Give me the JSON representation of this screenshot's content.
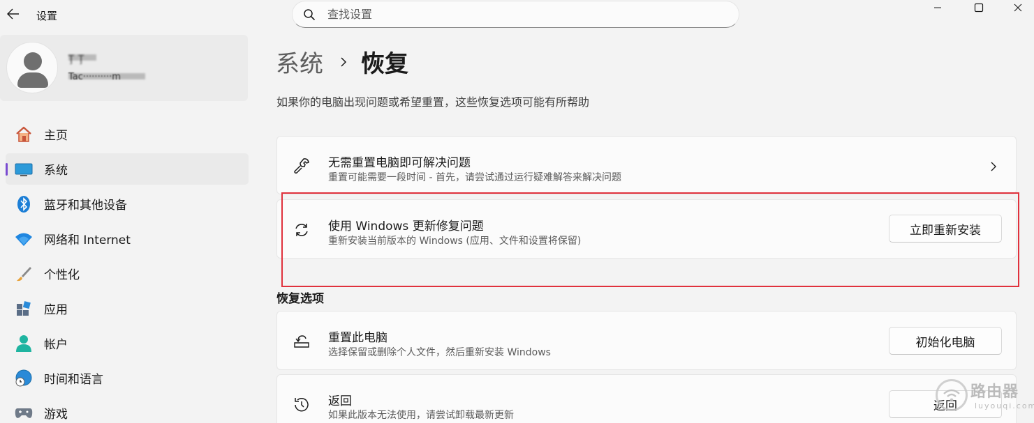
{
  "app": {
    "title": "设置"
  },
  "search": {
    "placeholder": "查找设置"
  },
  "profile": {
    "name": "Ţ Ţ",
    "email": "Tac··········m"
  },
  "sidebar": {
    "items": [
      {
        "label": "主页",
        "icon": "home-icon"
      },
      {
        "label": "系统",
        "icon": "system-icon",
        "active": true
      },
      {
        "label": "蓝牙和其他设备",
        "icon": "bluetooth-icon"
      },
      {
        "label": "网络和 Internet",
        "icon": "network-icon"
      },
      {
        "label": "个性化",
        "icon": "personalization-brush-icon"
      },
      {
        "label": "应用",
        "icon": "apps-icon"
      },
      {
        "label": "帐户",
        "icon": "account-icon"
      },
      {
        "label": "时间和语言",
        "icon": "time-language-icon"
      },
      {
        "label": "游戏",
        "icon": "gaming-icon"
      }
    ]
  },
  "breadcrumb": {
    "parent": "系统",
    "current": "恢复"
  },
  "subtitle": "如果你的电脑出现问题或希望重置，这些恢复选项可能有所帮助",
  "cards": {
    "troubleshoot": {
      "title": "无需重置电脑即可解决问题",
      "desc": "重置可能需要一段时间 - 首先，请尝试通过运行疑难解答来解决问题",
      "icon": "wrench-icon"
    },
    "windows_update": {
      "title": "使用 Windows 更新修复问题",
      "desc": "重新安装当前版本的 Windows (应用、文件和设置将保留)",
      "button": "立即重新安装",
      "icon": "sync-icon"
    }
  },
  "recovery_options": {
    "title": "恢复选项",
    "reset": {
      "title": "重置此电脑",
      "desc": "选择保留或删除个人文件，然后重新安装 Windows",
      "button": "初始化电脑",
      "icon": "reset-pc-icon"
    },
    "go_back": {
      "title": "返回",
      "desc": "如果此版本无法使用，请尝试卸载最新更新",
      "button": "返回",
      "icon": "history-icon"
    }
  },
  "watermark": {
    "text": "路由器",
    "sub": "luyouqi.com"
  },
  "colors": {
    "accent": "#7a4bd1",
    "highlight": "#e0313c",
    "background": "#f3f3f3",
    "card": "#fbfbfb"
  }
}
